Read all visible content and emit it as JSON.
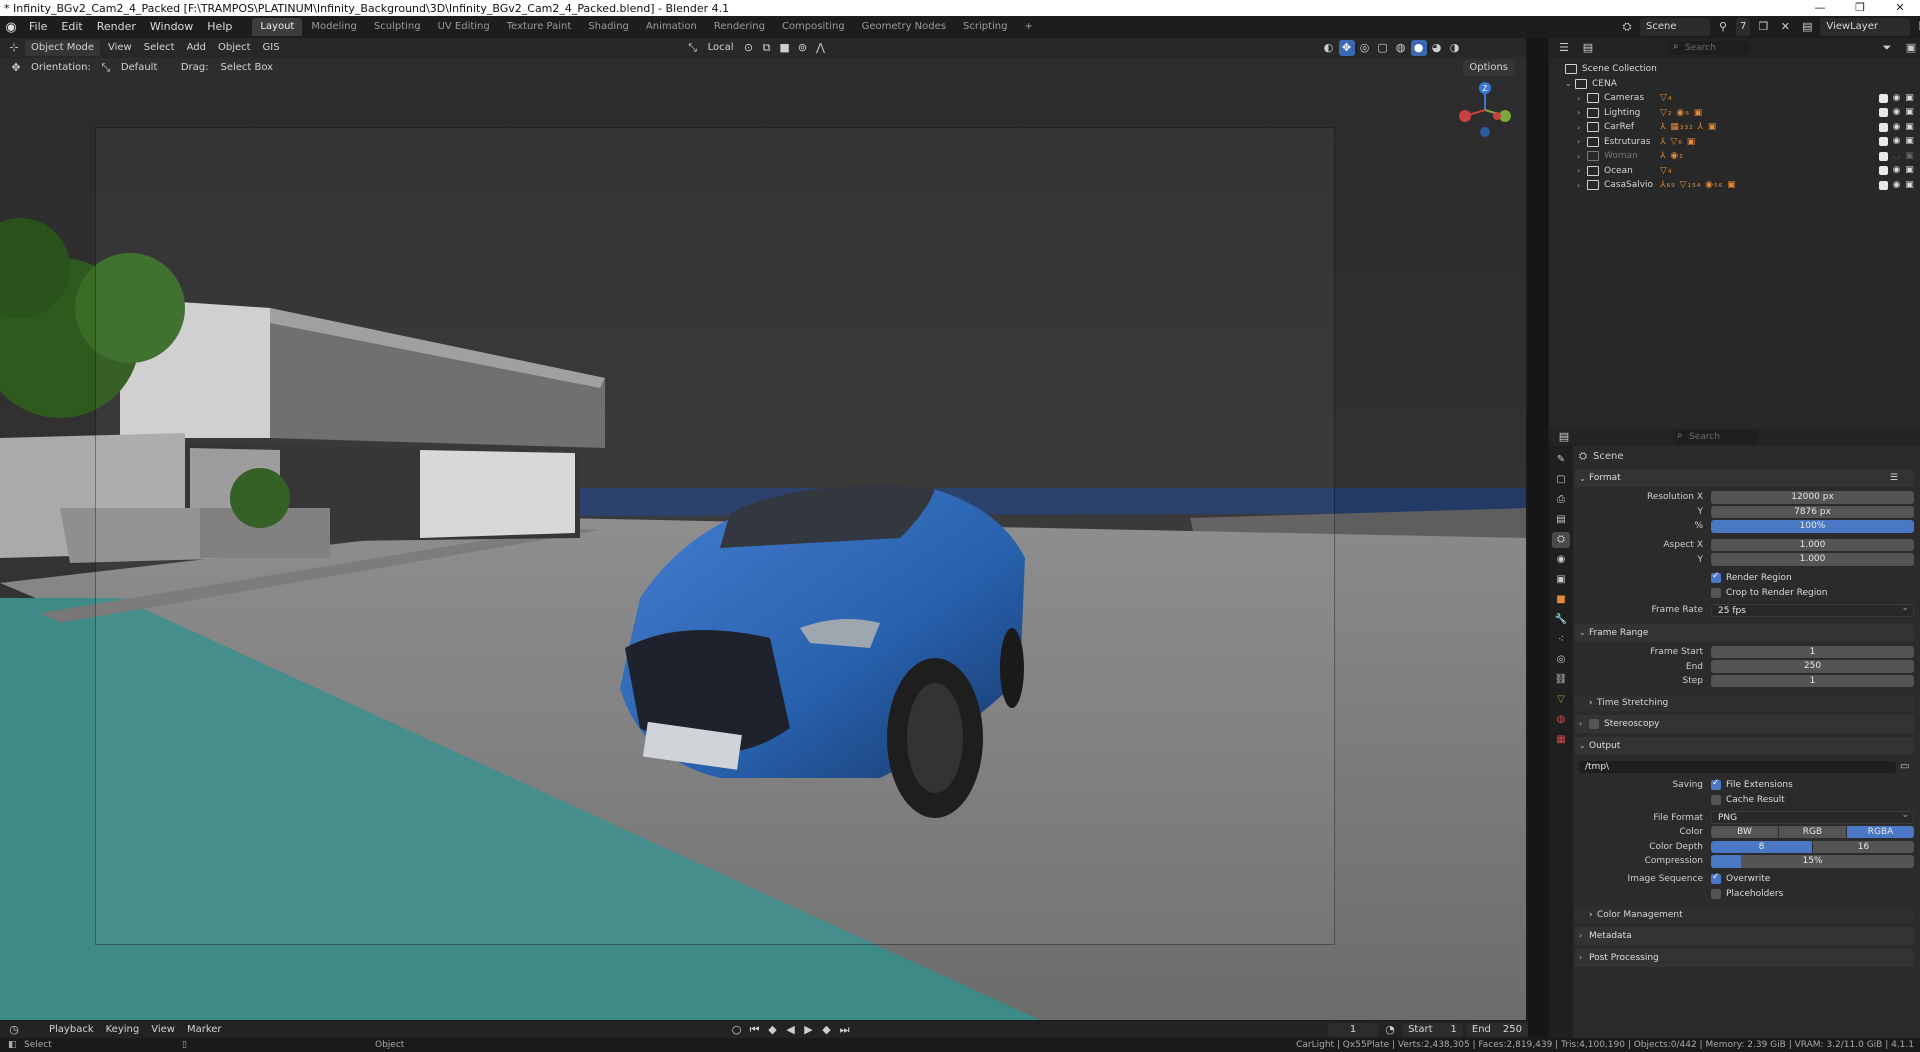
{
  "window": {
    "title": "* Infinity_BGv2_Cam2_4_Packed [F:\\TRAMPOS\\PLATINUM\\Infinity_Background\\3D\\Infinity_BGv2_Cam2_4_Packed.blend] - Blender 4.1"
  },
  "menubar": {
    "menus": [
      "File",
      "Edit",
      "Render",
      "Window",
      "Help"
    ],
    "workspaces": [
      "Layout",
      "Modeling",
      "Sculpting",
      "UV Editing",
      "Texture Paint",
      "Shading",
      "Animation",
      "Rendering",
      "Compositing",
      "Geometry Nodes",
      "Scripting"
    ],
    "active_workspace": "Layout",
    "add_tab": "+",
    "scene": "Scene",
    "scene_users": "7",
    "view_layer": "ViewLayer"
  },
  "viewport": {
    "mode": "Object Mode",
    "menus": [
      "View",
      "Select",
      "Add",
      "Object",
      "GIS"
    ],
    "transform_orientation": "Local",
    "orientation_label": "Orientation:",
    "orientation_value": "Default",
    "drag_label": "Drag:",
    "drag_value": "Select Box",
    "options": "Options",
    "gizmo_labels": {
      "z": "Z",
      "y": "Y",
      "x": "X"
    }
  },
  "timeline": {
    "menus": [
      "Playback",
      "Keying",
      "View",
      "Marker"
    ],
    "current_frame": "1",
    "start_label": "Start",
    "start": "1",
    "end_label": "End",
    "end": "250"
  },
  "statusbar": {
    "left": "Select",
    "middle": "Object",
    "right": "CarLight | Qx55Plate | Verts:2,438,305 | Faces:2,819,439 | Tris:4,100,190 | Objects:0/442 | Memory: 2.39 GiB | VRAM: 3.2/11.0 GiB | 4.1.1"
  },
  "outliner": {
    "search_placeholder": "Search",
    "root": "Scene Collection",
    "main": "CENA",
    "collections": [
      {
        "name": "Cameras",
        "tag": "▽₄"
      },
      {
        "name": "Lighting",
        "tag": "▽₂ ◉₆ ▣"
      },
      {
        "name": "CarRef",
        "tag": "⅄ ▦₃₃₂ ⅄ ▣"
      },
      {
        "name": "Estruturas",
        "tag": "⅄ ▽₆ ▣"
      },
      {
        "name": "Woman",
        "tag": "⅄ ◉₂"
      },
      {
        "name": "Ocean",
        "tag": "▽₄"
      },
      {
        "name": "CasaSalvio",
        "tag": "⅄₆₉ ▽₁₅₄ ◉₅₆ ▣"
      }
    ]
  },
  "properties": {
    "search_placeholder": "Search",
    "context": "Scene",
    "format": {
      "title": "Format",
      "resolution_x_label": "Resolution X",
      "resolution_x": "12000 px",
      "y_label": "Y",
      "resolution_y": "7876 px",
      "pct_label": "%",
      "pct": "100%",
      "aspect_x_label": "Aspect X",
      "aspect_x": "1.000",
      "aspect_y_label": "Y",
      "aspect_y": "1.000",
      "render_region": "Render Region",
      "crop_region": "Crop to Render Region",
      "frame_rate_label": "Frame Rate",
      "frame_rate": "25 fps"
    },
    "frame_range": {
      "title": "Frame Range",
      "start_label": "Frame Start",
      "start": "1",
      "end_label": "End",
      "end": "250",
      "step_label": "Step",
      "step": "1",
      "time_stretching": "Time Stretching"
    },
    "stereoscopy": "Stereoscopy",
    "output": {
      "title": "Output",
      "path": "/tmp\\",
      "saving_label": "Saving",
      "file_extensions": "File Extensions",
      "cache_result": "Cache Result",
      "file_format_label": "File Format",
      "file_format": "PNG",
      "color_label": "Color",
      "color_options": [
        "BW",
        "RGB",
        "RGBA"
      ],
      "color_selected": "RGBA",
      "depth_label": "Color Depth",
      "depth_options": [
        "8",
        "16"
      ],
      "depth_selected": "8",
      "compression_label": "Compression",
      "compression": "15%",
      "compression_value": 0.15,
      "image_seq_label": "Image Sequence",
      "overwrite": "Overwrite",
      "placeholders": "Placeholders",
      "color_management": "Color Management"
    },
    "metadata": "Metadata",
    "post_processing": "Post Processing"
  },
  "colors": {
    "accent": "#4a78c4",
    "car_blue": "#1f5aa8",
    "water": "#3e8a87",
    "collection_tag": "#e38a3a"
  }
}
